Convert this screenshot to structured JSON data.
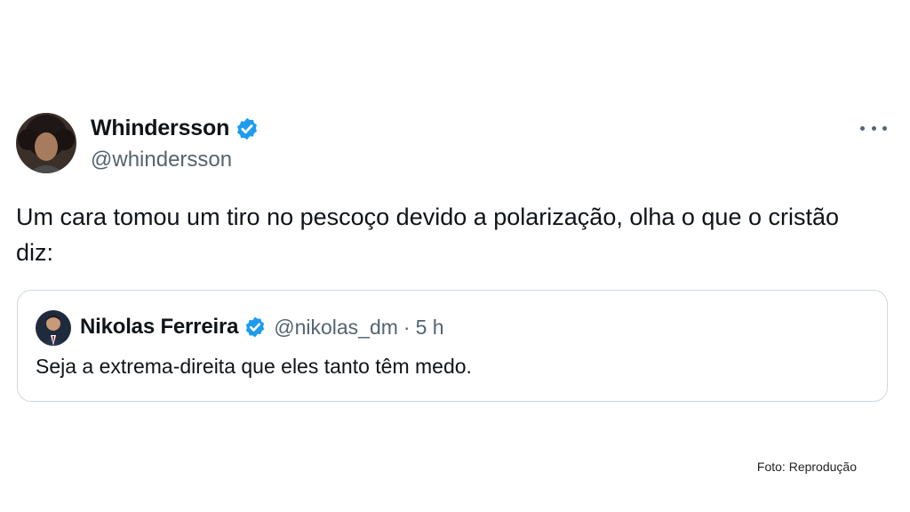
{
  "tweet": {
    "author": {
      "name": "Whindersson",
      "handle": "@whindersson",
      "verified": true
    },
    "text": "Um cara tomou um tiro no pescoço devido a polarização, olha o que o cristão diz:",
    "more_icon": "more-horizontal-icon",
    "quote": {
      "author": {
        "name": "Nikolas Ferreira",
        "handle": "@nikolas_dm",
        "verified": true
      },
      "separator": "·",
      "time": "5 h",
      "text": "Seja a extrema-direita que eles tanto têm medo."
    }
  },
  "credit": "Foto: Reprodução",
  "colors": {
    "verified": "#1d9bf0",
    "secondary_text": "#536471",
    "border": "#cfd9de"
  }
}
